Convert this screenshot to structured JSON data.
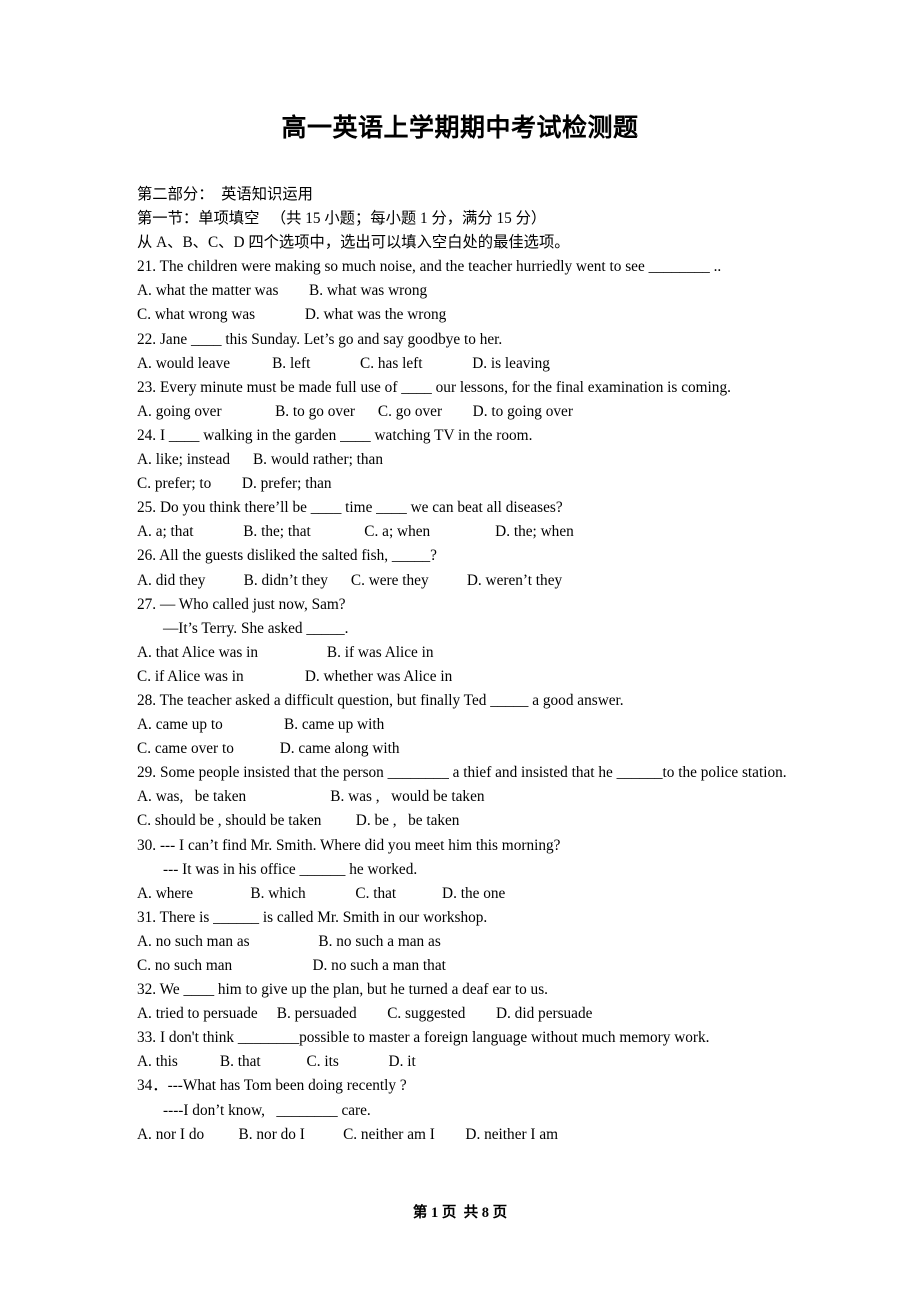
{
  "document": {
    "title": "高一英语上学期期中考试检测题",
    "footer": "第 1 页  共 8 页"
  },
  "section": {
    "part_heading": "第二部分：  英语知识运用",
    "sub_heading": "第一节：单项填空   （共 15 小题；每小题 1 分，满分 15 分）",
    "instruction": "从 A、B、C、D 四个选项中，选出可以填入空白处的最佳选项。"
  },
  "questions": [
    {
      "number": "21",
      "stem": "21. The children were making so much noise, and the teacher hurriedly went to see ________ ..",
      "option_lines": [
        "A. what the matter was        B. what was wrong",
        "C. what wrong was             D. what was the wrong"
      ]
    },
    {
      "number": "22",
      "stem": "22. Jane ____ this Sunday. Let’s go and say goodbye to her.",
      "option_lines": [
        "A. would leave           B. left             C. has left             D. is leaving"
      ]
    },
    {
      "number": "23",
      "stem": "23. Every minute must be made full use of ____ our lessons, for the final examination is coming.",
      "option_lines": [
        "A. going over              B. to go over      C. go over        D. to going over"
      ]
    },
    {
      "number": "24",
      "stem": "24. I ____ walking in the garden ____ watching TV in the room.",
      "option_lines": [
        "A. like; instead      B. would rather; than",
        "C. prefer; to        D. prefer; than"
      ]
    },
    {
      "number": "25",
      "stem": "25. Do you think there’ll be ____ time ____ we can beat all diseases?",
      "option_lines": [
        "A. a; that             B. the; that              C. a; when                 D. the; when"
      ]
    },
    {
      "number": "26",
      "stem": "26. All the guests disliked the salted fish, _____?",
      "option_lines": [
        "A. did they          B. didn’t they      C. were they          D. weren’t they"
      ]
    },
    {
      "number": "27",
      "stem": "27. — Who called just now, Sam?",
      "sub_lines": [
        "—It’s Terry. She asked _____."
      ],
      "option_lines": [
        "A. that Alice was in                  B. if was Alice in",
        "C. if Alice was in                D. whether was Alice in"
      ]
    },
    {
      "number": "28",
      "stem": "28. The teacher asked a difficult question, but finally Ted _____ a good answer.",
      "option_lines": [
        "A. came up to                B. came up with",
        "C. came over to            D. came along with"
      ]
    },
    {
      "number": "29",
      "stem": "29. Some people insisted that the person ________ a thief and insisted that he ______to the police station.",
      "option_lines": [
        "A. was,   be taken                      B. was ,   would be taken",
        "C. should be , should be taken         D. be ,   be taken"
      ]
    },
    {
      "number": "30",
      "stem": "30. --- I can’t find Mr. Smith. Where did you meet him this morning?",
      "sub_lines": [
        "--- It was in his office ______ he worked."
      ],
      "option_lines": [
        "A. where               B. which             C. that            D. the one"
      ]
    },
    {
      "number": "31",
      "stem": "31. There is ______ is called Mr. Smith in our workshop.",
      "option_lines": [
        "A. no such man as                  B. no such a man as",
        "C. no such man                     D. no such a man that"
      ]
    },
    {
      "number": "32",
      "stem": "32. We ____ him to give up the plan, but he turned a deaf ear to us.",
      "option_lines": [
        "A. tried to persuade     B. persuaded        C. suggested        D. did persuade"
      ]
    },
    {
      "number": "33",
      "stem": "33. I don't think ________possible to master a foreign language without much memory work.",
      "option_lines": [
        "A. this           B. that            C. its             D. it"
      ]
    },
    {
      "number": "34",
      "stem": "34．---What has Tom been doing recently ?",
      "sub_lines": [
        "----I don’t know,   ________ care."
      ],
      "option_lines": [
        "A. nor I do         B. nor do I          C. neither am I        D. neither I am"
      ]
    }
  ]
}
